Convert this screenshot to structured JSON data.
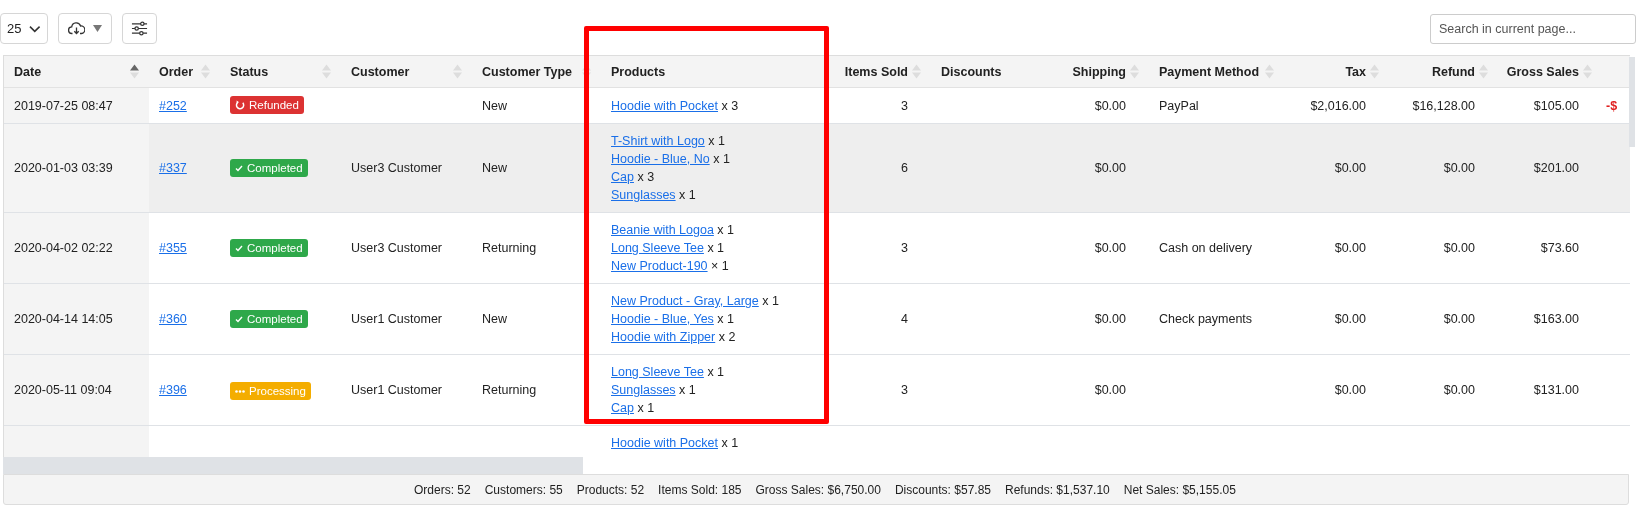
{
  "toolbar": {
    "page_size": "25",
    "search": {
      "placeholder": "Search in current page..."
    }
  },
  "table": {
    "columns": [
      {
        "label": "Date",
        "sorted": true
      },
      {
        "label": "Order",
        "sorted": false
      },
      {
        "label": "Status",
        "sorted": false
      },
      {
        "label": "Customer",
        "sorted": false
      },
      {
        "label": "Customer Type",
        "sorted": false
      },
      {
        "label": "Products"
      },
      {
        "label": "Items Sold",
        "sorted": false
      },
      {
        "label": "Discounts"
      },
      {
        "label": "Shipping",
        "sorted": false
      },
      {
        "label": "Payment Method",
        "sorted": false
      },
      {
        "label": "Tax",
        "sorted": false
      },
      {
        "label": "Refund",
        "sorted": false
      },
      {
        "label": "Gross Sales",
        "sorted": false
      }
    ],
    "rows": [
      {
        "highlighted": false,
        "date": "2019-07-25 08:47",
        "order": "#252",
        "status": {
          "kind": "refunded",
          "label": "Refunded"
        },
        "customer_type": "New",
        "products": [
          {
            "name": "Hoodie with Pocket",
            "qty": "x 3"
          }
        ],
        "items_sold": "3",
        "shipping": "$0.00",
        "payment_method": "PayPal",
        "tax": "$2,016.00",
        "refund": "$16,128.00",
        "gross_sales": "$105.00",
        "column_13": "-$"
      },
      {
        "highlighted": true,
        "date": "2020-01-03 03:39",
        "order": "#337",
        "status": {
          "kind": "completed",
          "label": "Completed"
        },
        "customer": "User3 Customer",
        "customer_type": "New",
        "products": [
          {
            "name": "T-Shirt with Logo",
            "qty": "x 1"
          },
          {
            "name": "Hoodie - Blue, No",
            "qty": "x 1"
          },
          {
            "name": "Cap",
            "qty": "x 3"
          },
          {
            "name": "Sunglasses",
            "qty": "x 1"
          }
        ],
        "items_sold": "6",
        "shipping": "$0.00",
        "tax": "$0.00",
        "refund": "$0.00",
        "gross_sales": "$201.00"
      },
      {
        "highlighted": false,
        "date": "2020-04-02 02:22",
        "order": "#355",
        "status": {
          "kind": "completed",
          "label": "Completed"
        },
        "customer": "User3 Customer",
        "customer_type": "Returning",
        "products": [
          {
            "name": "Beanie with Logoa",
            "qty": "x 1"
          },
          {
            "name": "Long Sleeve Tee",
            "qty": "x 1"
          },
          {
            "name": "New Product-190",
            "qty": "× 1"
          }
        ],
        "items_sold": "3",
        "shipping": "$0.00",
        "payment_method": "Cash on delivery",
        "tax": "$0.00",
        "refund": "$0.00",
        "gross_sales": "$73.60"
      },
      {
        "highlighted": false,
        "date": "2020-04-14 14:05",
        "order": "#360",
        "status": {
          "kind": "completed",
          "label": "Completed"
        },
        "customer": "User1 Customer",
        "customer_type": "New",
        "products": [
          {
            "name": "New Product - Gray, Large",
            "qty": "x 1"
          },
          {
            "name": "Hoodie - Blue, Yes",
            "qty": "x 1"
          },
          {
            "name": "Hoodie with Zipper",
            "qty": "x 2"
          }
        ],
        "items_sold": "4",
        "shipping": "$0.00",
        "payment_method": "Check payments",
        "tax": "$0.00",
        "refund": "$0.00",
        "gross_sales": "$163.00"
      },
      {
        "highlighted": false,
        "date": "2020-05-11 09:04",
        "order": "#396",
        "status": {
          "kind": "processing",
          "label": "Processing"
        },
        "customer": "User1 Customer",
        "customer_type": "Returning",
        "products": [
          {
            "name": "Long Sleeve Tee",
            "qty": "x 1"
          },
          {
            "name": "Sunglasses",
            "qty": "x 1"
          },
          {
            "name": "Cap",
            "qty": "x 1"
          }
        ],
        "items_sold": "3",
        "shipping": "$0.00",
        "tax": "$0.00",
        "refund": "$0.00",
        "gross_sales": "$131.00"
      },
      {
        "highlighted": false,
        "products": [
          {
            "name": "Hoodie with Pocket",
            "qty": "x 1"
          }
        ]
      }
    ]
  },
  "summary": [
    "Orders: 52",
    "Customers: 55",
    "Products: 52",
    "Items Sold: 185",
    "Gross Sales: $6,750.00",
    "Discounts: $57.85",
    "Refunds: $1,537.10",
    "Net Sales: $5,155.05"
  ]
}
